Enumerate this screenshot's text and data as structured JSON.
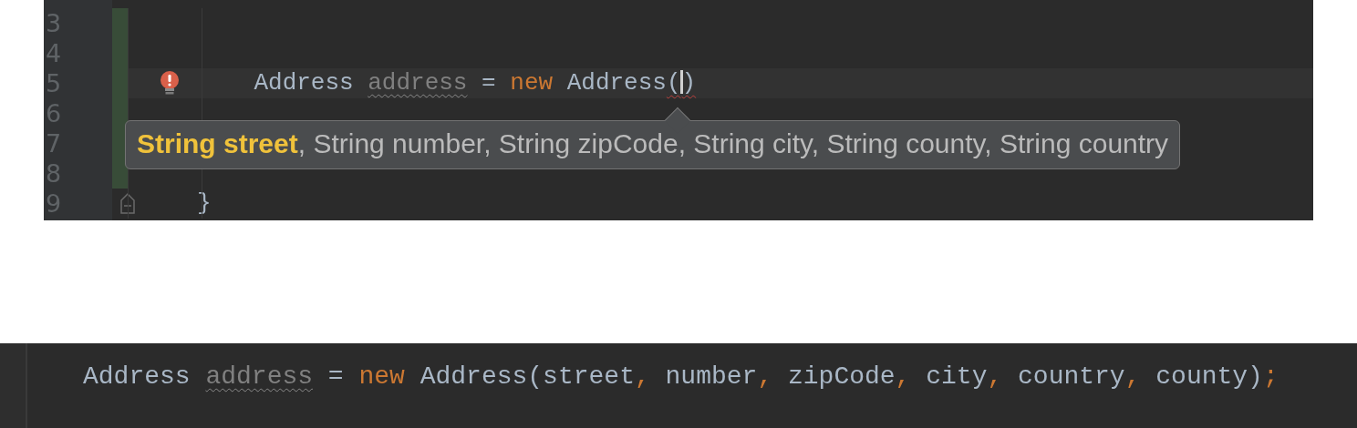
{
  "editor_top": {
    "lines": [
      {
        "number": "3",
        "changed": true,
        "current": false
      },
      {
        "number": "4",
        "changed": true,
        "current": false
      },
      {
        "number": "5",
        "changed": true,
        "current": true,
        "intention_bulb": true,
        "tokens": [
          {
            "text": "    Address ",
            "kind": "type"
          },
          {
            "text": "address",
            "kind": "unused"
          },
          {
            "text": " = ",
            "kind": "plain"
          },
          {
            "text": "new",
            "kind": "keyword"
          },
          {
            "text": " Address",
            "kind": "type"
          },
          {
            "text": "(",
            "kind": "plain",
            "error": true,
            "caret": true
          },
          {
            "text": ")",
            "kind": "plain",
            "error": true
          }
        ]
      },
      {
        "number": "6",
        "changed": true,
        "current": false
      },
      {
        "number": "7",
        "changed": true,
        "current": false
      },
      {
        "number": "8",
        "changed": true,
        "current": false
      },
      {
        "number": "9",
        "changed": false,
        "current": false,
        "fold_marker": true,
        "tokens": [
          {
            "text": "}",
            "kind": "plain"
          }
        ]
      }
    ],
    "parameter_hint": {
      "separator": ", ",
      "params": [
        {
          "text": "String street",
          "current": true
        },
        {
          "text": "String number",
          "current": false
        },
        {
          "text": "String zipCode",
          "current": false
        },
        {
          "text": "String city",
          "current": false
        },
        {
          "text": "String county",
          "current": false
        },
        {
          "text": "String country",
          "current": false
        }
      ]
    }
  },
  "editor_bottom": {
    "lines": [
      {
        "tokens": [
          {
            "text": "Address ",
            "kind": "type"
          },
          {
            "text": "address",
            "kind": "unused"
          },
          {
            "text": " = ",
            "kind": "plain"
          },
          {
            "text": "new",
            "kind": "keyword"
          },
          {
            "text": " Address(street",
            "kind": "plain"
          },
          {
            "text": ",",
            "kind": "punct"
          },
          {
            "text": " number",
            "kind": "plain"
          },
          {
            "text": ",",
            "kind": "punct"
          },
          {
            "text": " zipCode",
            "kind": "plain"
          },
          {
            "text": ",",
            "kind": "punct"
          },
          {
            "text": " city",
            "kind": "plain"
          },
          {
            "text": ",",
            "kind": "punct"
          },
          {
            "text": " country",
            "kind": "plain"
          },
          {
            "text": ",",
            "kind": "punct"
          },
          {
            "text": " county)",
            "kind": "plain"
          },
          {
            "text": ";",
            "kind": "punct"
          }
        ]
      }
    ]
  }
}
